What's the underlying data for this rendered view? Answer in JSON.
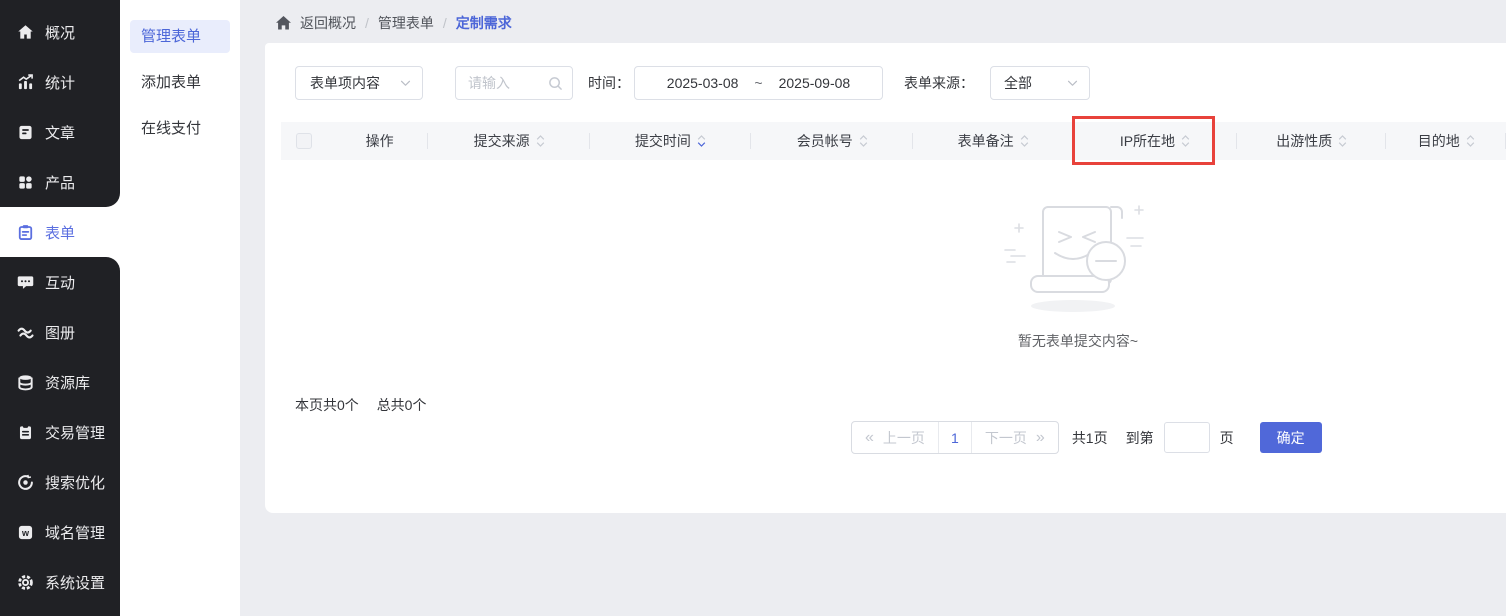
{
  "colors": {
    "accent_blue": "#4c66d8",
    "sidebar_active_blue": "#5b6fe0",
    "button_blue": "#5068d9",
    "highlight_red": "#e8423b",
    "sidebar_dark": "#202125"
  },
  "sidebar": {
    "items": [
      "概况",
      "统计",
      "文章",
      "产品",
      "表单",
      "互动",
      "图册",
      "资源库",
      "交易管理",
      "搜索优化",
      "域名管理",
      "系统设置"
    ],
    "active_item": "表单"
  },
  "subsidebar": {
    "items": [
      "管理表单",
      "添加表单",
      "在线支付"
    ],
    "active_item": "管理表单"
  },
  "breadcrumb": {
    "items": [
      "返回概况",
      "管理表单",
      "定制需求"
    ],
    "separator": "/",
    "active_item": "定制需求"
  },
  "filters": {
    "field_select_value": "表单项内容",
    "keyword_placeholder": "请输入",
    "time_label": "时间：",
    "date_start": "2025-03-08",
    "date_separator": "~",
    "date_end": "2025-09-08",
    "source_label": "表单来源：",
    "source_select_value": "全部"
  },
  "table": {
    "columns": [
      "操作",
      "提交来源",
      "提交时间",
      "会员帐号",
      "表单备注",
      "IP所在地",
      "出游性质",
      "目的地"
    ],
    "sorted_column": "提交时间",
    "sort_direction": "desc",
    "highlighted_column": "IP所在地",
    "rows": []
  },
  "empty_state": {
    "message": "暂无表单提交内容~"
  },
  "summary": {
    "page_count_text": "本页共0个",
    "total_count_text": "总共0个"
  },
  "pagination": {
    "prev_icon": "«",
    "prev_label": "上一页",
    "current_page": "1",
    "next_label": "下一页",
    "next_icon": "»",
    "total_pages_text": "共1页",
    "goto_prefix": "到第",
    "goto_suffix": "页",
    "confirm_label": "确定"
  }
}
